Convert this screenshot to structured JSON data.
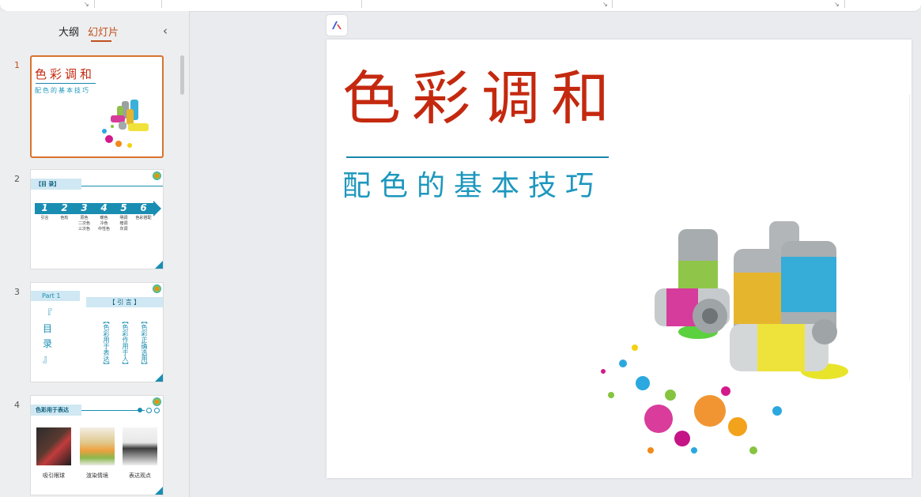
{
  "panel": {
    "tab_outline": "大纲",
    "tab_slides": "幻灯片",
    "collapse_glyph": "‹"
  },
  "slides": [
    {
      "number": "1",
      "title": "色彩调和",
      "subtitle": "配色的基本技巧"
    },
    {
      "number": "2",
      "header": "【目  录】",
      "steps": [
        "1",
        "2",
        "3",
        "4",
        "5",
        "6"
      ],
      "labels": [
        "引言",
        "色轮",
        "原色\n二次色\n三次色",
        "暖色\n冷色\n中性色",
        "明调\n暗调\n灰调",
        "色彩搭配"
      ]
    },
    {
      "number": "3",
      "part": "Part 1",
      "banner": "【  引  言  】",
      "toc_marks": [
        "『",
        "目",
        "录",
        "』"
      ],
      "columns": [
        "【色彩用于表达】",
        "【色彩作用于人】",
        "【色彩正确选用】"
      ]
    },
    {
      "number": "4",
      "header": "色彩用于表达",
      "captions": [
        "吸引眼球",
        "渲染情境",
        "表达观点"
      ]
    }
  ],
  "main_slide": {
    "title": "色彩调和",
    "subtitle": "配色的基本技巧"
  },
  "colors": {
    "accent": "#c0501e",
    "title_red": "#c4290f",
    "subtitle_blue": "#1d97bd",
    "slide_blue": "#1a8db2"
  }
}
